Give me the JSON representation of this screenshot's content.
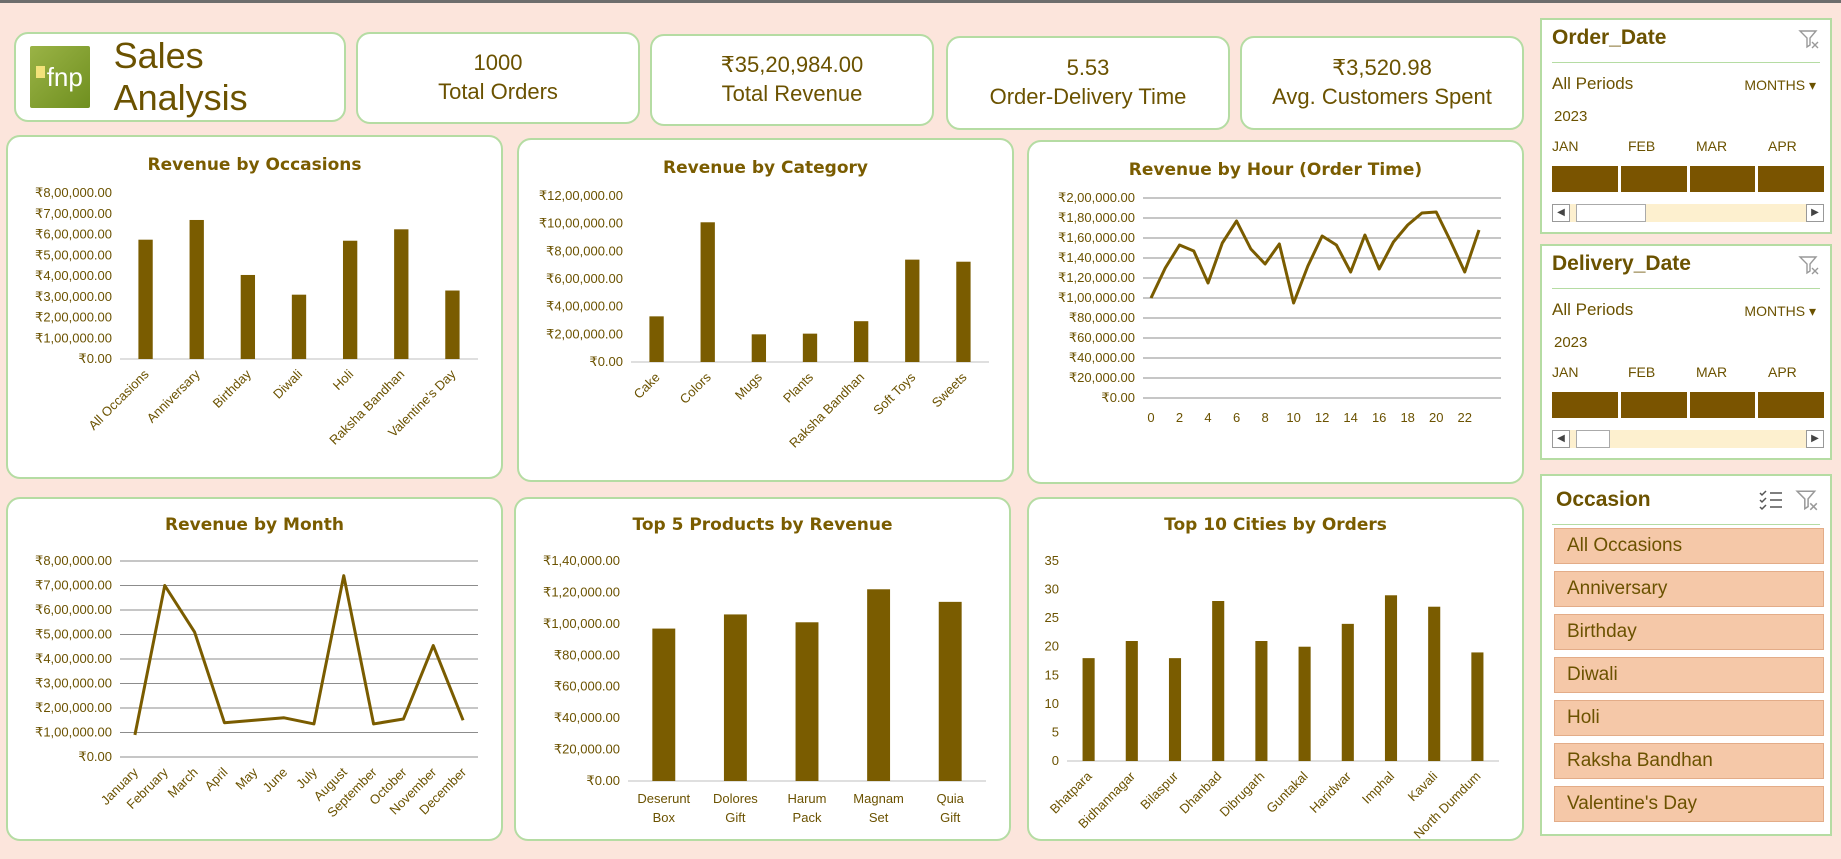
{
  "header": {
    "logo_text": "fnp",
    "title": "Sales Analysis"
  },
  "kpis": [
    {
      "value": "1000",
      "label": "Total Orders"
    },
    {
      "value": "₹35,20,984.00",
      "label": "Total Revenue"
    },
    {
      "value": "5.53",
      "label": "Order-Delivery Time"
    },
    {
      "value": "₹3,520.98",
      "label": "Avg. Customers Spent"
    }
  ],
  "colors": {
    "bar": "#7a5c00",
    "background": "#fce5dc",
    "border": "#b5dca3",
    "slicer_item": "#f5c8a8"
  },
  "slicers": {
    "order_date": {
      "title": "Order_Date",
      "periods": "All Periods",
      "level": "MONTHS",
      "year": "2023",
      "months": [
        "JAN",
        "FEB",
        "MAR",
        "APR"
      ]
    },
    "delivery_date": {
      "title": "Delivery_Date",
      "periods": "All Periods",
      "level": "MONTHS",
      "year": "2023",
      "months": [
        "JAN",
        "FEB",
        "MAR",
        "APR"
      ]
    },
    "occasion": {
      "title": "Occasion",
      "items": [
        "All Occasions",
        "Anniversary",
        "Birthday",
        "Diwali",
        "Holi",
        "Raksha Bandhan",
        "Valentine's Day"
      ]
    }
  },
  "chart_data": [
    {
      "id": "occasions",
      "type": "bar",
      "title": "Revenue by Occasions",
      "categories": [
        "All Occasions",
        "Anniversary",
        "Birthday",
        "Diwali",
        "Holi",
        "Raksha Bandhan",
        "Valentine's Day"
      ],
      "values": [
        575000,
        670000,
        405000,
        310000,
        570000,
        625000,
        330000
      ],
      "ylim": [
        0,
        800000
      ],
      "ticks": [
        "₹0.00",
        "₹1,00,000.00",
        "₹2,00,000.00",
        "₹3,00,000.00",
        "₹4,00,000.00",
        "₹5,00,000.00",
        "₹6,00,000.00",
        "₹7,00,000.00",
        "₹8,00,000.00"
      ],
      "grid": false
    },
    {
      "id": "category",
      "type": "bar",
      "title": "Revenue by Category",
      "categories": [
        "Cake",
        "Colors",
        "Mugs",
        "Plants",
        "Raksha Bandhan",
        "Soft Toys",
        "Sweets"
      ],
      "values": [
        330000,
        1010000,
        200000,
        205000,
        295000,
        740000,
        725000
      ],
      "ylim": [
        0,
        1200000
      ],
      "ticks": [
        "₹0.00",
        "₹2,00,000.00",
        "₹4,00,000.00",
        "₹6,00,000.00",
        "₹8,00,000.00",
        "₹10,00,000.00",
        "₹12,00,000.00"
      ],
      "grid": false
    },
    {
      "id": "hour",
      "type": "line",
      "title": "Revenue by Hour (Order Time)",
      "x": [
        0,
        1,
        2,
        3,
        4,
        5,
        6,
        7,
        8,
        9,
        10,
        11,
        12,
        13,
        14,
        15,
        16,
        17,
        18,
        19,
        20,
        21,
        22,
        23
      ],
      "values": [
        100000,
        130000,
        153000,
        147000,
        115000,
        155000,
        177000,
        149000,
        134000,
        154000,
        95000,
        132000,
        162000,
        153000,
        126000,
        163000,
        129000,
        156000,
        173000,
        185000,
        186000,
        157000,
        126000,
        168000
      ],
      "ylim": [
        0,
        200000
      ],
      "ticks": [
        "₹0.00",
        "₹20,000.00",
        "₹40,000.00",
        "₹60,000.00",
        "₹80,000.00",
        "₹1,00,000.00",
        "₹1,20,000.00",
        "₹1,40,000.00",
        "₹1,60,000.00",
        "₹1,80,000.00",
        "₹2,00,000.00"
      ],
      "xticks": [
        "0",
        "2",
        "4",
        "6",
        "8",
        "10",
        "12",
        "14",
        "16",
        "18",
        "20",
        "22"
      ],
      "grid": true
    },
    {
      "id": "month",
      "type": "line",
      "title": "Revenue by Month",
      "categories": [
        "January",
        "February",
        "March",
        "April",
        "May",
        "June",
        "July",
        "August",
        "September",
        "October",
        "November",
        "December"
      ],
      "values": [
        90000,
        700000,
        510000,
        140000,
        150000,
        160000,
        135000,
        740000,
        135000,
        155000,
        455000,
        150000
      ],
      "ylim": [
        0,
        800000
      ],
      "ticks": [
        "₹0.00",
        "₹1,00,000.00",
        "₹2,00,000.00",
        "₹3,00,000.00",
        "₹4,00,000.00",
        "₹5,00,000.00",
        "₹6,00,000.00",
        "₹7,00,000.00",
        "₹8,00,000.00"
      ],
      "grid": true
    },
    {
      "id": "products",
      "type": "bar",
      "title": "Top 5 Products by Revenue",
      "categories": [
        "Deserunt Box",
        "Dolores Gift",
        "Harum Pack",
        "Magnam Set",
        "Quia Gift"
      ],
      "values": [
        97000,
        106000,
        101000,
        122000,
        114000
      ],
      "ylim": [
        0,
        140000
      ],
      "ticks": [
        "₹0.00",
        "₹20,000.00",
        "₹40,000.00",
        "₹60,000.00",
        "₹80,000.00",
        "₹1,00,000.00",
        "₹1,20,000.00",
        "₹1,40,000.00"
      ],
      "grid": false
    },
    {
      "id": "cities",
      "type": "bar",
      "title": "Top 10 Cities by Orders",
      "categories": [
        "Bhatpara",
        "Bidhannagar",
        "Bilaspur",
        "Dhanbad",
        "Dibrugarh",
        "Guntakal",
        "Haridwar",
        "Imphal",
        "Kavali",
        "North Dumdum"
      ],
      "values": [
        18,
        21,
        18,
        28,
        21,
        20,
        24,
        29,
        27,
        19
      ],
      "ylim": [
        0,
        35
      ],
      "ticks": [
        "0",
        "5",
        "10",
        "15",
        "20",
        "25",
        "30",
        "35"
      ],
      "grid": false
    }
  ]
}
